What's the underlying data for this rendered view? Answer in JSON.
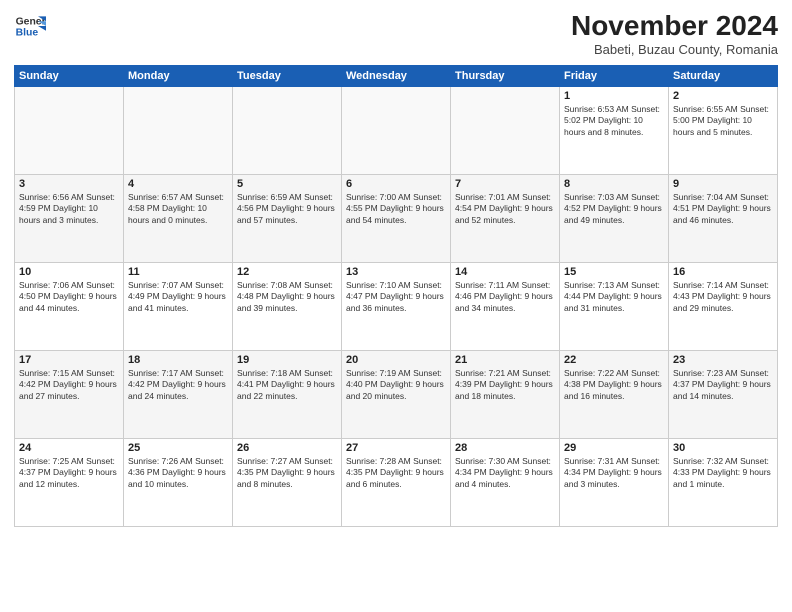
{
  "logo": {
    "line1": "General",
    "line2": "Blue"
  },
  "title": "November 2024",
  "subtitle": "Babeti, Buzau County, Romania",
  "headers": [
    "Sunday",
    "Monday",
    "Tuesday",
    "Wednesday",
    "Thursday",
    "Friday",
    "Saturday"
  ],
  "weeks": [
    [
      {
        "day": "",
        "detail": ""
      },
      {
        "day": "",
        "detail": ""
      },
      {
        "day": "",
        "detail": ""
      },
      {
        "day": "",
        "detail": ""
      },
      {
        "day": "",
        "detail": ""
      },
      {
        "day": "1",
        "detail": "Sunrise: 6:53 AM\nSunset: 5:02 PM\nDaylight: 10 hours\nand 8 minutes."
      },
      {
        "day": "2",
        "detail": "Sunrise: 6:55 AM\nSunset: 5:00 PM\nDaylight: 10 hours\nand 5 minutes."
      }
    ],
    [
      {
        "day": "3",
        "detail": "Sunrise: 6:56 AM\nSunset: 4:59 PM\nDaylight: 10 hours\nand 3 minutes."
      },
      {
        "day": "4",
        "detail": "Sunrise: 6:57 AM\nSunset: 4:58 PM\nDaylight: 10 hours\nand 0 minutes."
      },
      {
        "day": "5",
        "detail": "Sunrise: 6:59 AM\nSunset: 4:56 PM\nDaylight: 9 hours\nand 57 minutes."
      },
      {
        "day": "6",
        "detail": "Sunrise: 7:00 AM\nSunset: 4:55 PM\nDaylight: 9 hours\nand 54 minutes."
      },
      {
        "day": "7",
        "detail": "Sunrise: 7:01 AM\nSunset: 4:54 PM\nDaylight: 9 hours\nand 52 minutes."
      },
      {
        "day": "8",
        "detail": "Sunrise: 7:03 AM\nSunset: 4:52 PM\nDaylight: 9 hours\nand 49 minutes."
      },
      {
        "day": "9",
        "detail": "Sunrise: 7:04 AM\nSunset: 4:51 PM\nDaylight: 9 hours\nand 46 minutes."
      }
    ],
    [
      {
        "day": "10",
        "detail": "Sunrise: 7:06 AM\nSunset: 4:50 PM\nDaylight: 9 hours\nand 44 minutes."
      },
      {
        "day": "11",
        "detail": "Sunrise: 7:07 AM\nSunset: 4:49 PM\nDaylight: 9 hours\nand 41 minutes."
      },
      {
        "day": "12",
        "detail": "Sunrise: 7:08 AM\nSunset: 4:48 PM\nDaylight: 9 hours\nand 39 minutes."
      },
      {
        "day": "13",
        "detail": "Sunrise: 7:10 AM\nSunset: 4:47 PM\nDaylight: 9 hours\nand 36 minutes."
      },
      {
        "day": "14",
        "detail": "Sunrise: 7:11 AM\nSunset: 4:46 PM\nDaylight: 9 hours\nand 34 minutes."
      },
      {
        "day": "15",
        "detail": "Sunrise: 7:13 AM\nSunset: 4:44 PM\nDaylight: 9 hours\nand 31 minutes."
      },
      {
        "day": "16",
        "detail": "Sunrise: 7:14 AM\nSunset: 4:43 PM\nDaylight: 9 hours\nand 29 minutes."
      }
    ],
    [
      {
        "day": "17",
        "detail": "Sunrise: 7:15 AM\nSunset: 4:42 PM\nDaylight: 9 hours\nand 27 minutes."
      },
      {
        "day": "18",
        "detail": "Sunrise: 7:17 AM\nSunset: 4:42 PM\nDaylight: 9 hours\nand 24 minutes."
      },
      {
        "day": "19",
        "detail": "Sunrise: 7:18 AM\nSunset: 4:41 PM\nDaylight: 9 hours\nand 22 minutes."
      },
      {
        "day": "20",
        "detail": "Sunrise: 7:19 AM\nSunset: 4:40 PM\nDaylight: 9 hours\nand 20 minutes."
      },
      {
        "day": "21",
        "detail": "Sunrise: 7:21 AM\nSunset: 4:39 PM\nDaylight: 9 hours\nand 18 minutes."
      },
      {
        "day": "22",
        "detail": "Sunrise: 7:22 AM\nSunset: 4:38 PM\nDaylight: 9 hours\nand 16 minutes."
      },
      {
        "day": "23",
        "detail": "Sunrise: 7:23 AM\nSunset: 4:37 PM\nDaylight: 9 hours\nand 14 minutes."
      }
    ],
    [
      {
        "day": "24",
        "detail": "Sunrise: 7:25 AM\nSunset: 4:37 PM\nDaylight: 9 hours\nand 12 minutes."
      },
      {
        "day": "25",
        "detail": "Sunrise: 7:26 AM\nSunset: 4:36 PM\nDaylight: 9 hours\nand 10 minutes."
      },
      {
        "day": "26",
        "detail": "Sunrise: 7:27 AM\nSunset: 4:35 PM\nDaylight: 9 hours\nand 8 minutes."
      },
      {
        "day": "27",
        "detail": "Sunrise: 7:28 AM\nSunset: 4:35 PM\nDaylight: 9 hours\nand 6 minutes."
      },
      {
        "day": "28",
        "detail": "Sunrise: 7:30 AM\nSunset: 4:34 PM\nDaylight: 9 hours\nand 4 minutes."
      },
      {
        "day": "29",
        "detail": "Sunrise: 7:31 AM\nSunset: 4:34 PM\nDaylight: 9 hours\nand 3 minutes."
      },
      {
        "day": "30",
        "detail": "Sunrise: 7:32 AM\nSunset: 4:33 PM\nDaylight: 9 hours\nand 1 minute."
      }
    ]
  ]
}
